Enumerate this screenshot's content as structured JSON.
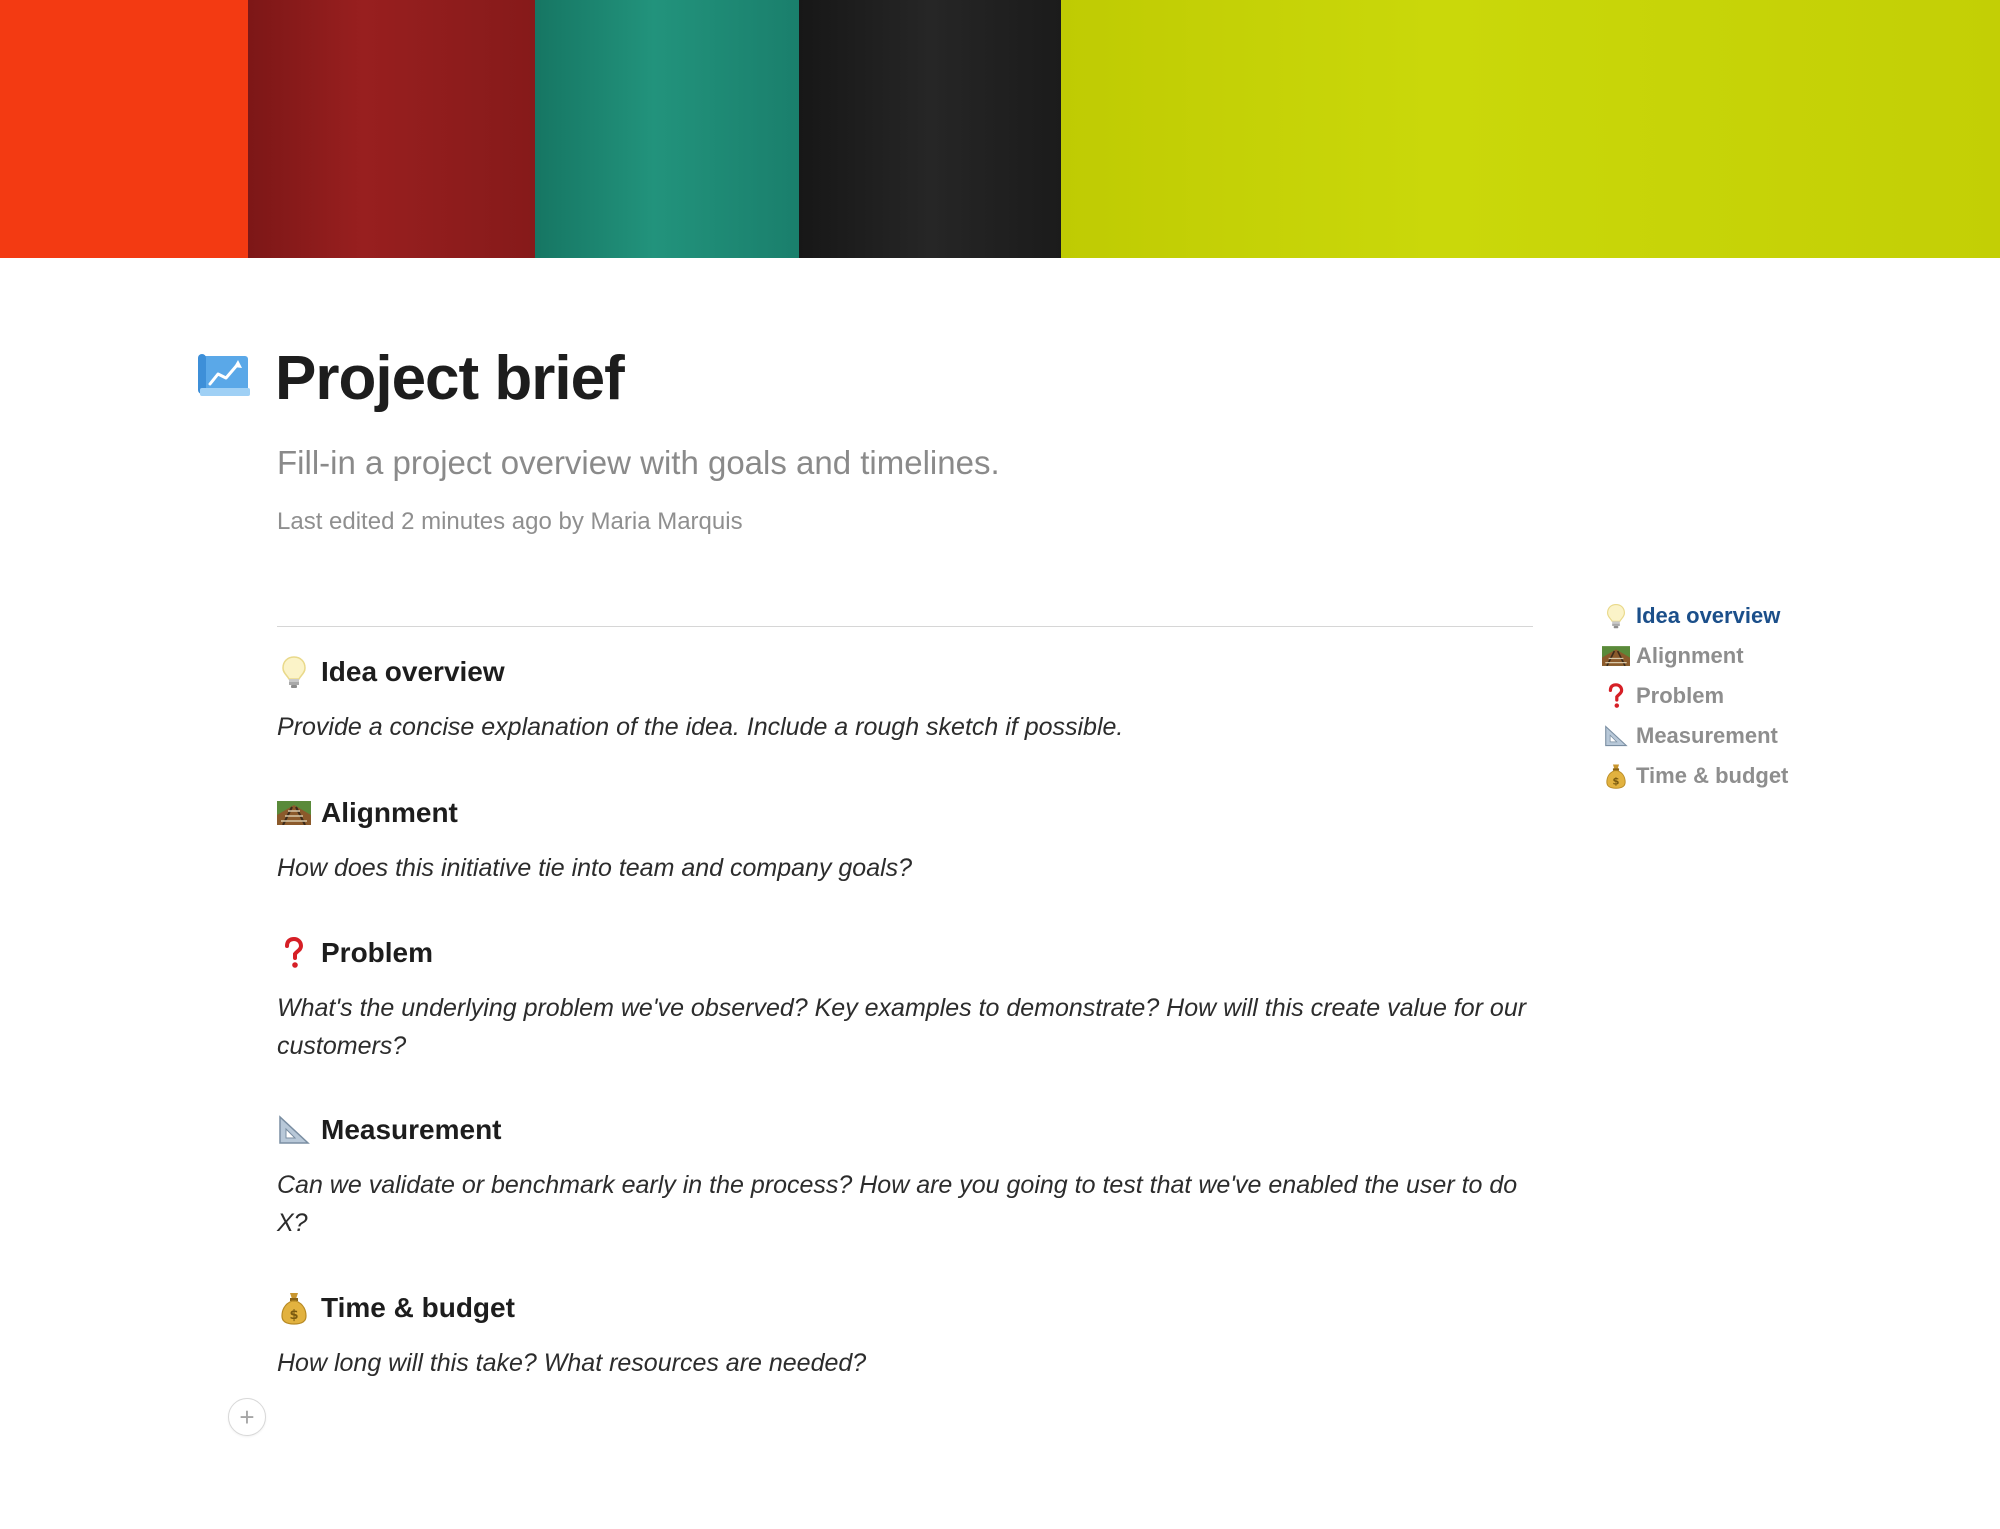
{
  "cover": {
    "colors": [
      "#f33a12",
      "#8c1c1c",
      "#1e8a75",
      "#202020",
      "#c6d305"
    ]
  },
  "page": {
    "icon": "chart-increasing-icon",
    "title": "Project brief",
    "subtitle": "Fill-in a project overview with goals and timelines.",
    "last_edited": "Last edited 2 minutes ago by Maria Marquis"
  },
  "sections": [
    {
      "icon": "lightbulb-icon",
      "heading": "Idea overview",
      "body": "Provide a concise explanation of the idea. Include a rough sketch if possible."
    },
    {
      "icon": "railway-track-icon",
      "heading": "Alignment",
      "body": "How does this initiative tie into team and company goals?"
    },
    {
      "icon": "red-question-mark-icon",
      "heading": "Problem",
      "body": "What's the underlying problem we've observed? Key examples to demonstrate? How will this create value for our customers?"
    },
    {
      "icon": "triangular-ruler-icon",
      "heading": "Measurement",
      "body": "Can we validate or benchmark early in the process? How are you going to test that we've enabled the user to do X?"
    },
    {
      "icon": "money-bag-icon",
      "heading": "Time & budget",
      "body": "How long will this take? What resources are needed?"
    }
  ],
  "toc": {
    "active_index": 0,
    "active_color": "#1b4f8a",
    "items": [
      {
        "icon": "lightbulb-icon",
        "label": "Idea overview"
      },
      {
        "icon": "railway-track-icon",
        "label": "Alignment"
      },
      {
        "icon": "red-question-mark-icon",
        "label": "Problem"
      },
      {
        "icon": "triangular-ruler-icon",
        "label": "Measurement"
      },
      {
        "icon": "money-bag-icon",
        "label": "Time & budget"
      }
    ]
  },
  "add_block": {
    "symbol": "+"
  }
}
